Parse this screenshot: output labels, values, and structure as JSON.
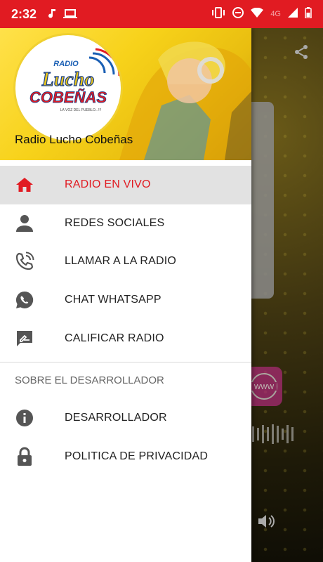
{
  "status_bar": {
    "time": "2:32",
    "network": "4G",
    "icons": [
      "music-note-icon",
      "laptop-icon",
      "vibrate-icon",
      "do-not-disturb-icon",
      "wifi-icon",
      "signal-icon",
      "battery-icon"
    ]
  },
  "drawer": {
    "logo": {
      "top_text": "RADIO",
      "line1": "Lucho",
      "line2": "COBEÑAS",
      "tagline": "LA VOZ DEL PUEBLO...!!!"
    },
    "header_title": "Radio Lucho Cobeñas",
    "menu": [
      {
        "label": "RADIO EN VIVO",
        "icon": "home-icon",
        "active": true
      },
      {
        "label": "REDES SOCIALES",
        "icon": "person-icon",
        "active": false
      },
      {
        "label": "LLAMAR A LA RADIO",
        "icon": "phone-call-icon",
        "active": false
      },
      {
        "label": "CHAT WHATSAPP",
        "icon": "whatsapp-icon",
        "active": false
      },
      {
        "label": "CALIFICAR RADIO",
        "icon": "rate-review-icon",
        "active": false
      }
    ],
    "section_title": "SOBRE EL DESARROLLADOR",
    "developer_menu": [
      {
        "label": "DESARROLLADOR",
        "icon": "info-icon"
      },
      {
        "label": "POLITICA DE PRIVACIDAD",
        "icon": "lock-icon"
      }
    ]
  },
  "background": {
    "www_label": "WWW"
  },
  "colors": {
    "accent": "#e11b22",
    "header_yellow": "#f7d21a",
    "icon_gray": "#555555"
  }
}
